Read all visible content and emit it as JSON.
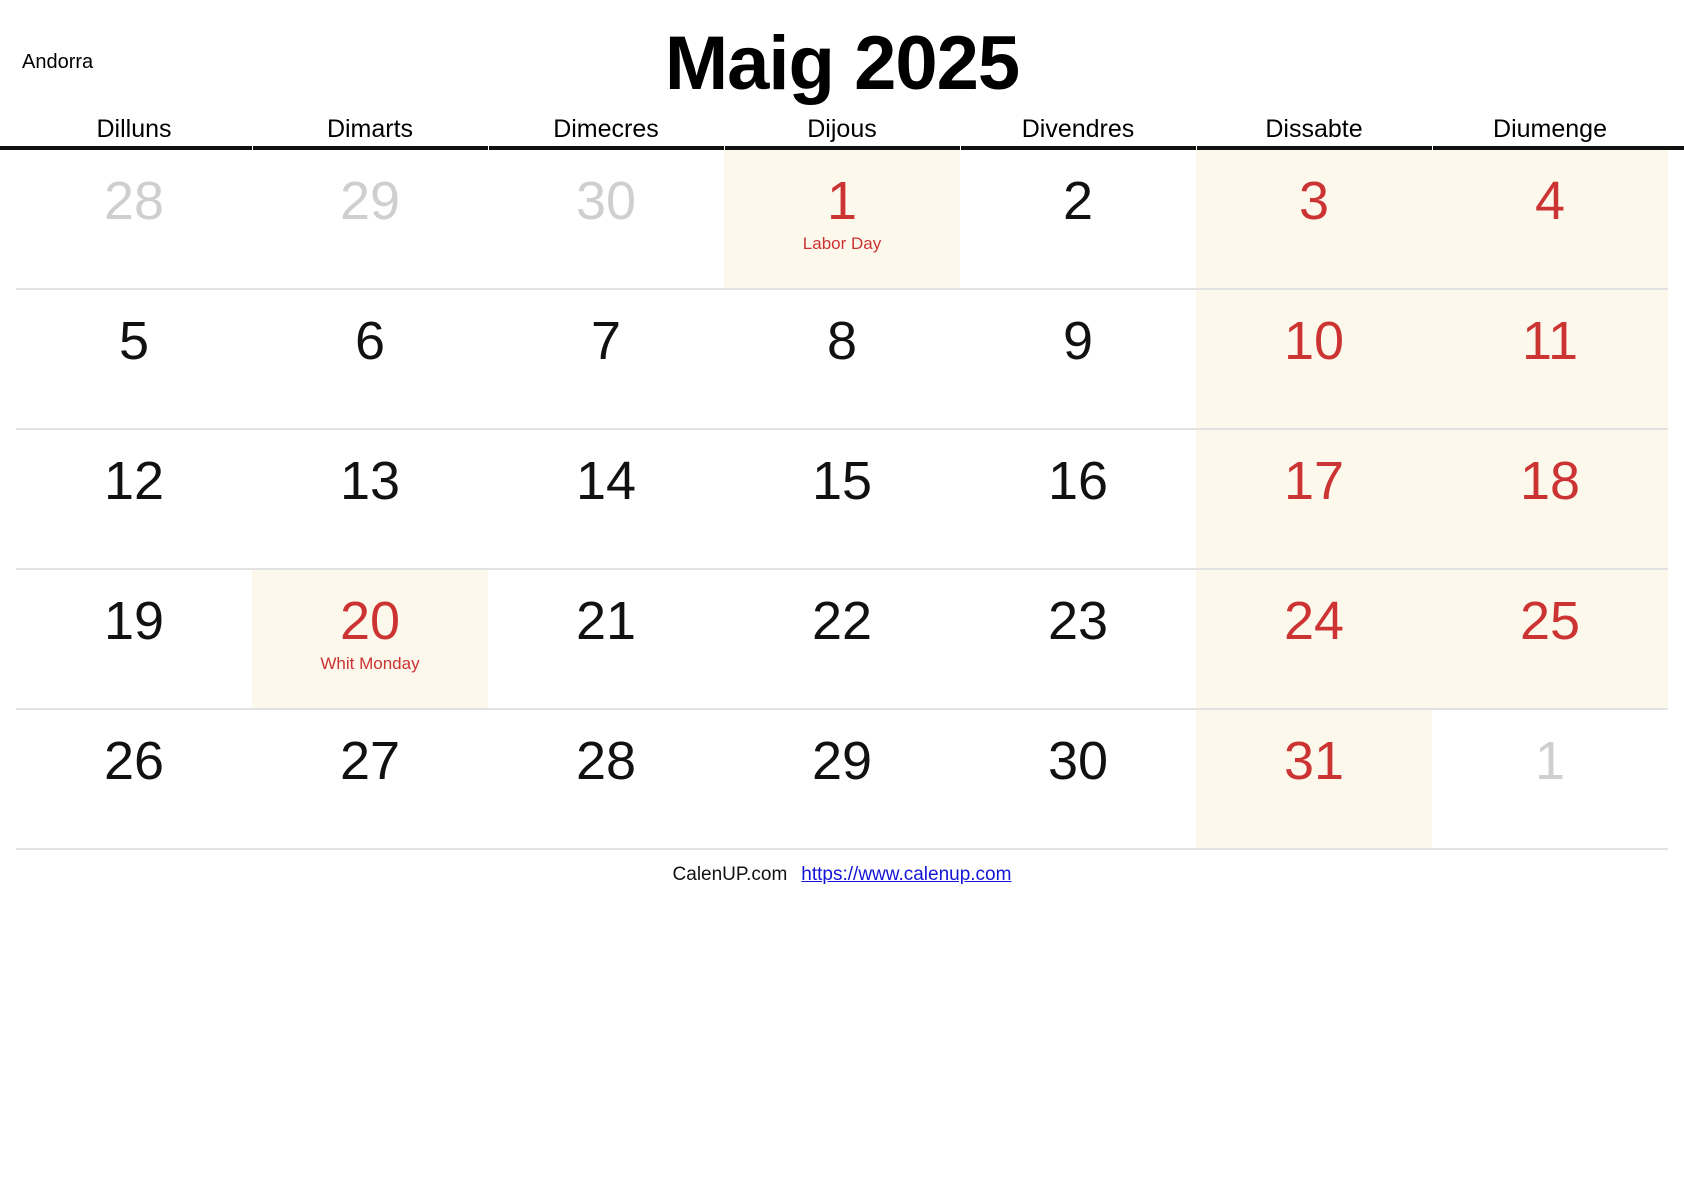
{
  "header": {
    "country": "Andorra",
    "title": "Maig 2025"
  },
  "weekdays": [
    {
      "label": "Dilluns"
    },
    {
      "label": "Dimarts"
    },
    {
      "label": "Dimecres"
    },
    {
      "label": "Dijous"
    },
    {
      "label": "Divendres"
    },
    {
      "label": "Dissabte"
    },
    {
      "label": "Diumenge"
    }
  ],
  "colors": {
    "holiday_red": "#cc3333",
    "weekend_bg": "#fdf8ec",
    "muted_gray": "#cfcfcf",
    "header_rule": "#111111",
    "link_blue": "#1414d6"
  },
  "weeks": [
    [
      {
        "num": "28",
        "style": "muted",
        "bg": "none",
        "holiday": ""
      },
      {
        "num": "29",
        "style": "muted",
        "bg": "none",
        "holiday": ""
      },
      {
        "num": "30",
        "style": "muted",
        "bg": "none",
        "holiday": ""
      },
      {
        "num": "1",
        "style": "red",
        "bg": "holiday",
        "holiday": "Labor Day"
      },
      {
        "num": "2",
        "style": "normal",
        "bg": "none",
        "holiday": ""
      },
      {
        "num": "3",
        "style": "red",
        "bg": "weekend",
        "holiday": ""
      },
      {
        "num": "4",
        "style": "red",
        "bg": "weekend",
        "holiday": ""
      }
    ],
    [
      {
        "num": "5",
        "style": "normal",
        "bg": "none",
        "holiday": ""
      },
      {
        "num": "6",
        "style": "normal",
        "bg": "none",
        "holiday": ""
      },
      {
        "num": "7",
        "style": "normal",
        "bg": "none",
        "holiday": ""
      },
      {
        "num": "8",
        "style": "normal",
        "bg": "none",
        "holiday": ""
      },
      {
        "num": "9",
        "style": "normal",
        "bg": "none",
        "holiday": ""
      },
      {
        "num": "10",
        "style": "red",
        "bg": "weekend",
        "holiday": ""
      },
      {
        "num": "11",
        "style": "red",
        "bg": "weekend",
        "holiday": ""
      }
    ],
    [
      {
        "num": "12",
        "style": "normal",
        "bg": "none",
        "holiday": ""
      },
      {
        "num": "13",
        "style": "normal",
        "bg": "none",
        "holiday": ""
      },
      {
        "num": "14",
        "style": "normal",
        "bg": "none",
        "holiday": ""
      },
      {
        "num": "15",
        "style": "normal",
        "bg": "none",
        "holiday": ""
      },
      {
        "num": "16",
        "style": "normal",
        "bg": "none",
        "holiday": ""
      },
      {
        "num": "17",
        "style": "red",
        "bg": "weekend",
        "holiday": ""
      },
      {
        "num": "18",
        "style": "red",
        "bg": "weekend",
        "holiday": ""
      }
    ],
    [
      {
        "num": "19",
        "style": "normal",
        "bg": "none",
        "holiday": ""
      },
      {
        "num": "20",
        "style": "red",
        "bg": "holiday",
        "holiday": "Whit Monday"
      },
      {
        "num": "21",
        "style": "normal",
        "bg": "none",
        "holiday": ""
      },
      {
        "num": "22",
        "style": "normal",
        "bg": "none",
        "holiday": ""
      },
      {
        "num": "23",
        "style": "normal",
        "bg": "none",
        "holiday": ""
      },
      {
        "num": "24",
        "style": "red",
        "bg": "weekend",
        "holiday": ""
      },
      {
        "num": "25",
        "style": "red",
        "bg": "weekend",
        "holiday": ""
      }
    ],
    [
      {
        "num": "26",
        "style": "normal",
        "bg": "none",
        "holiday": ""
      },
      {
        "num": "27",
        "style": "normal",
        "bg": "none",
        "holiday": ""
      },
      {
        "num": "28",
        "style": "normal",
        "bg": "none",
        "holiday": ""
      },
      {
        "num": "29",
        "style": "normal",
        "bg": "none",
        "holiday": ""
      },
      {
        "num": "30",
        "style": "normal",
        "bg": "none",
        "holiday": ""
      },
      {
        "num": "31",
        "style": "red",
        "bg": "weekend",
        "holiday": ""
      },
      {
        "num": "1",
        "style": "muted",
        "bg": "none",
        "holiday": ""
      }
    ]
  ],
  "footer": {
    "brand": "CalenUP.com",
    "url": "https://www.calenup.com"
  }
}
